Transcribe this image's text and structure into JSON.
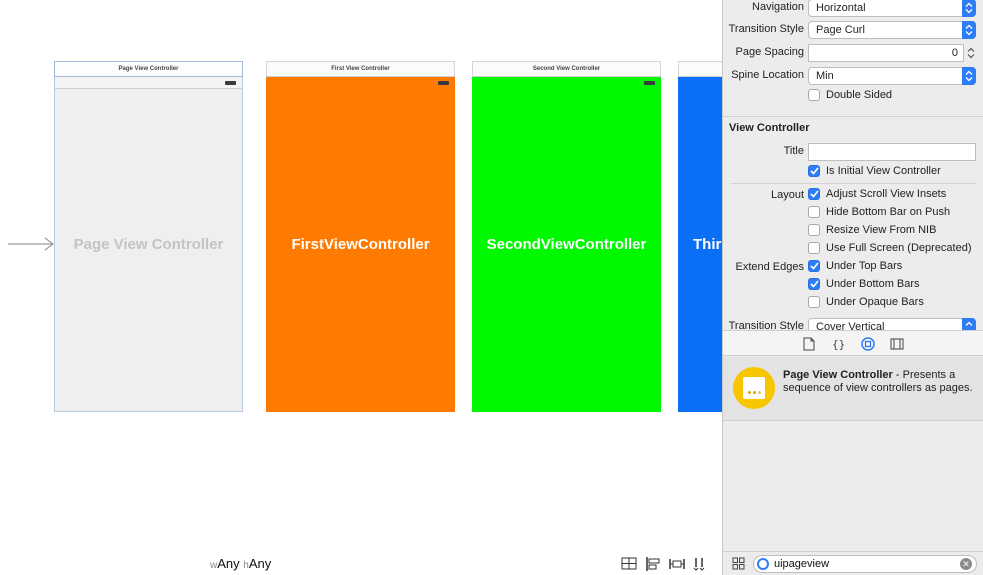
{
  "canvas": {
    "scenes": [
      {
        "title": "Page View Controller",
        "label": "Page View Controller"
      },
      {
        "title": "First View Controller",
        "label": "FirstViewController"
      },
      {
        "title": "Second View Controller",
        "label": "SecondViewController"
      },
      {
        "title": "",
        "label": "Thir"
      }
    ],
    "size_class": {
      "w_prefix": "w",
      "w_value": "Any",
      "h_prefix": "h",
      "h_value": "Any"
    }
  },
  "inspector": {
    "page_view_controller": {
      "navigation": {
        "label": "Navigation",
        "value": "Horizontal"
      },
      "transition_style": {
        "label": "Transition Style",
        "value": "Page Curl"
      },
      "page_spacing": {
        "label": "Page Spacing",
        "value": "0"
      },
      "spine_location": {
        "label": "Spine Location",
        "value": "Min"
      },
      "double_sided": {
        "label": "Double Sided",
        "checked": false
      }
    },
    "view_controller": {
      "section_title": "View Controller",
      "title_label": "Title",
      "title_value": "",
      "is_initial": {
        "label": "Is Initial View Controller",
        "checked": true
      },
      "layout_label": "Layout",
      "layout_options": [
        {
          "label": "Adjust Scroll View Insets",
          "checked": true
        },
        {
          "label": "Hide Bottom Bar on Push",
          "checked": false
        },
        {
          "label": "Resize View From NIB",
          "checked": false
        },
        {
          "label": "Use Full Screen (Deprecated)",
          "checked": false
        }
      ],
      "extend_edges_label": "Extend Edges",
      "extend_edges_options": [
        {
          "label": "Under Top Bars",
          "checked": true
        },
        {
          "label": "Under Bottom Bars",
          "checked": true
        },
        {
          "label": "Under Opaque Bars",
          "checked": false
        }
      ],
      "transition_style": {
        "label": "Transition Style",
        "value": "Cover Vertical"
      }
    }
  },
  "library": {
    "item_name": "Page View Controller",
    "item_description": " - Presents a sequence of view controllers as pages.",
    "filter_value": "uipageview"
  },
  "colors": {
    "first": "#ff7a00",
    "second": "#00f800",
    "third": "#0a6ff5",
    "accent": "#2f7df6",
    "library_icon": "#f7c600"
  }
}
